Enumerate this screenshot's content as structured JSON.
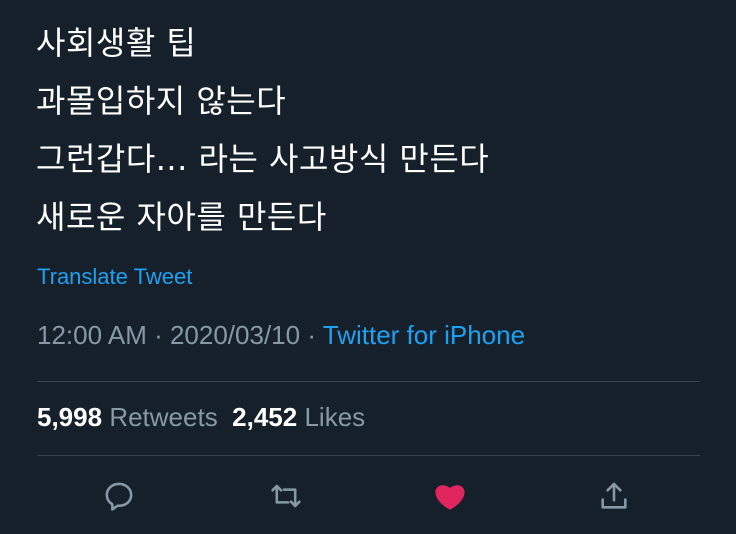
{
  "tweet": {
    "lines": [
      "사회생활 팁",
      "과몰입하지 않는다",
      "그런갑다... 라는 사고방식 만든다",
      "새로운 자아를 만든다"
    ],
    "translate_label": "Translate Tweet",
    "time": "12:00 AM",
    "separator": " · ",
    "date": "2020/03/10",
    "source": "Twitter for iPhone"
  },
  "stats": {
    "retweets_count": "5,998",
    "retweets_label": "Retweets",
    "likes_count": "2,452",
    "likes_label": "Likes"
  },
  "actions": [
    {
      "icon": "reply-icon"
    },
    {
      "icon": "retweet-icon"
    },
    {
      "icon": "heart-icon",
      "liked": true
    },
    {
      "icon": "share-icon"
    }
  ],
  "colors": {
    "background": "#15202b",
    "text": "#ffffff",
    "secondary": "#8899a6",
    "link": "#1da1f2",
    "like": "#e0245e",
    "divider": "#38444d"
  }
}
